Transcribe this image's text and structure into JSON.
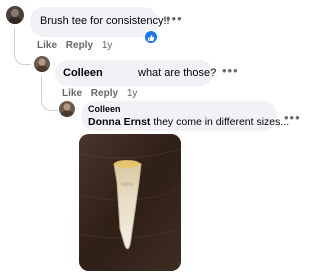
{
  "comments": [
    {
      "text": "Brush tee for consistency!!",
      "actions": {
        "like": "Like",
        "reply": "Reply",
        "time": "1y"
      },
      "reaction_icon": "like-icon",
      "more_icon": "more-icon"
    },
    {
      "author": "Colleen",
      "text": "what are those?",
      "actions": {
        "like": "Like",
        "reply": "Reply",
        "time": "1y"
      },
      "more_icon": "more-icon"
    },
    {
      "author": "Colleen",
      "mention": "Donna Ernst",
      "text": " they come in different sizes...",
      "more_icon": "more-icon",
      "attachment": "photo of a small clear plastic tooth-shaped tool on wood table"
    }
  ],
  "colors": {
    "bubble": "#f0f2f5",
    "muted": "#65676b",
    "like_blue": "#1877f2",
    "thread_line": "#ced0d4"
  }
}
